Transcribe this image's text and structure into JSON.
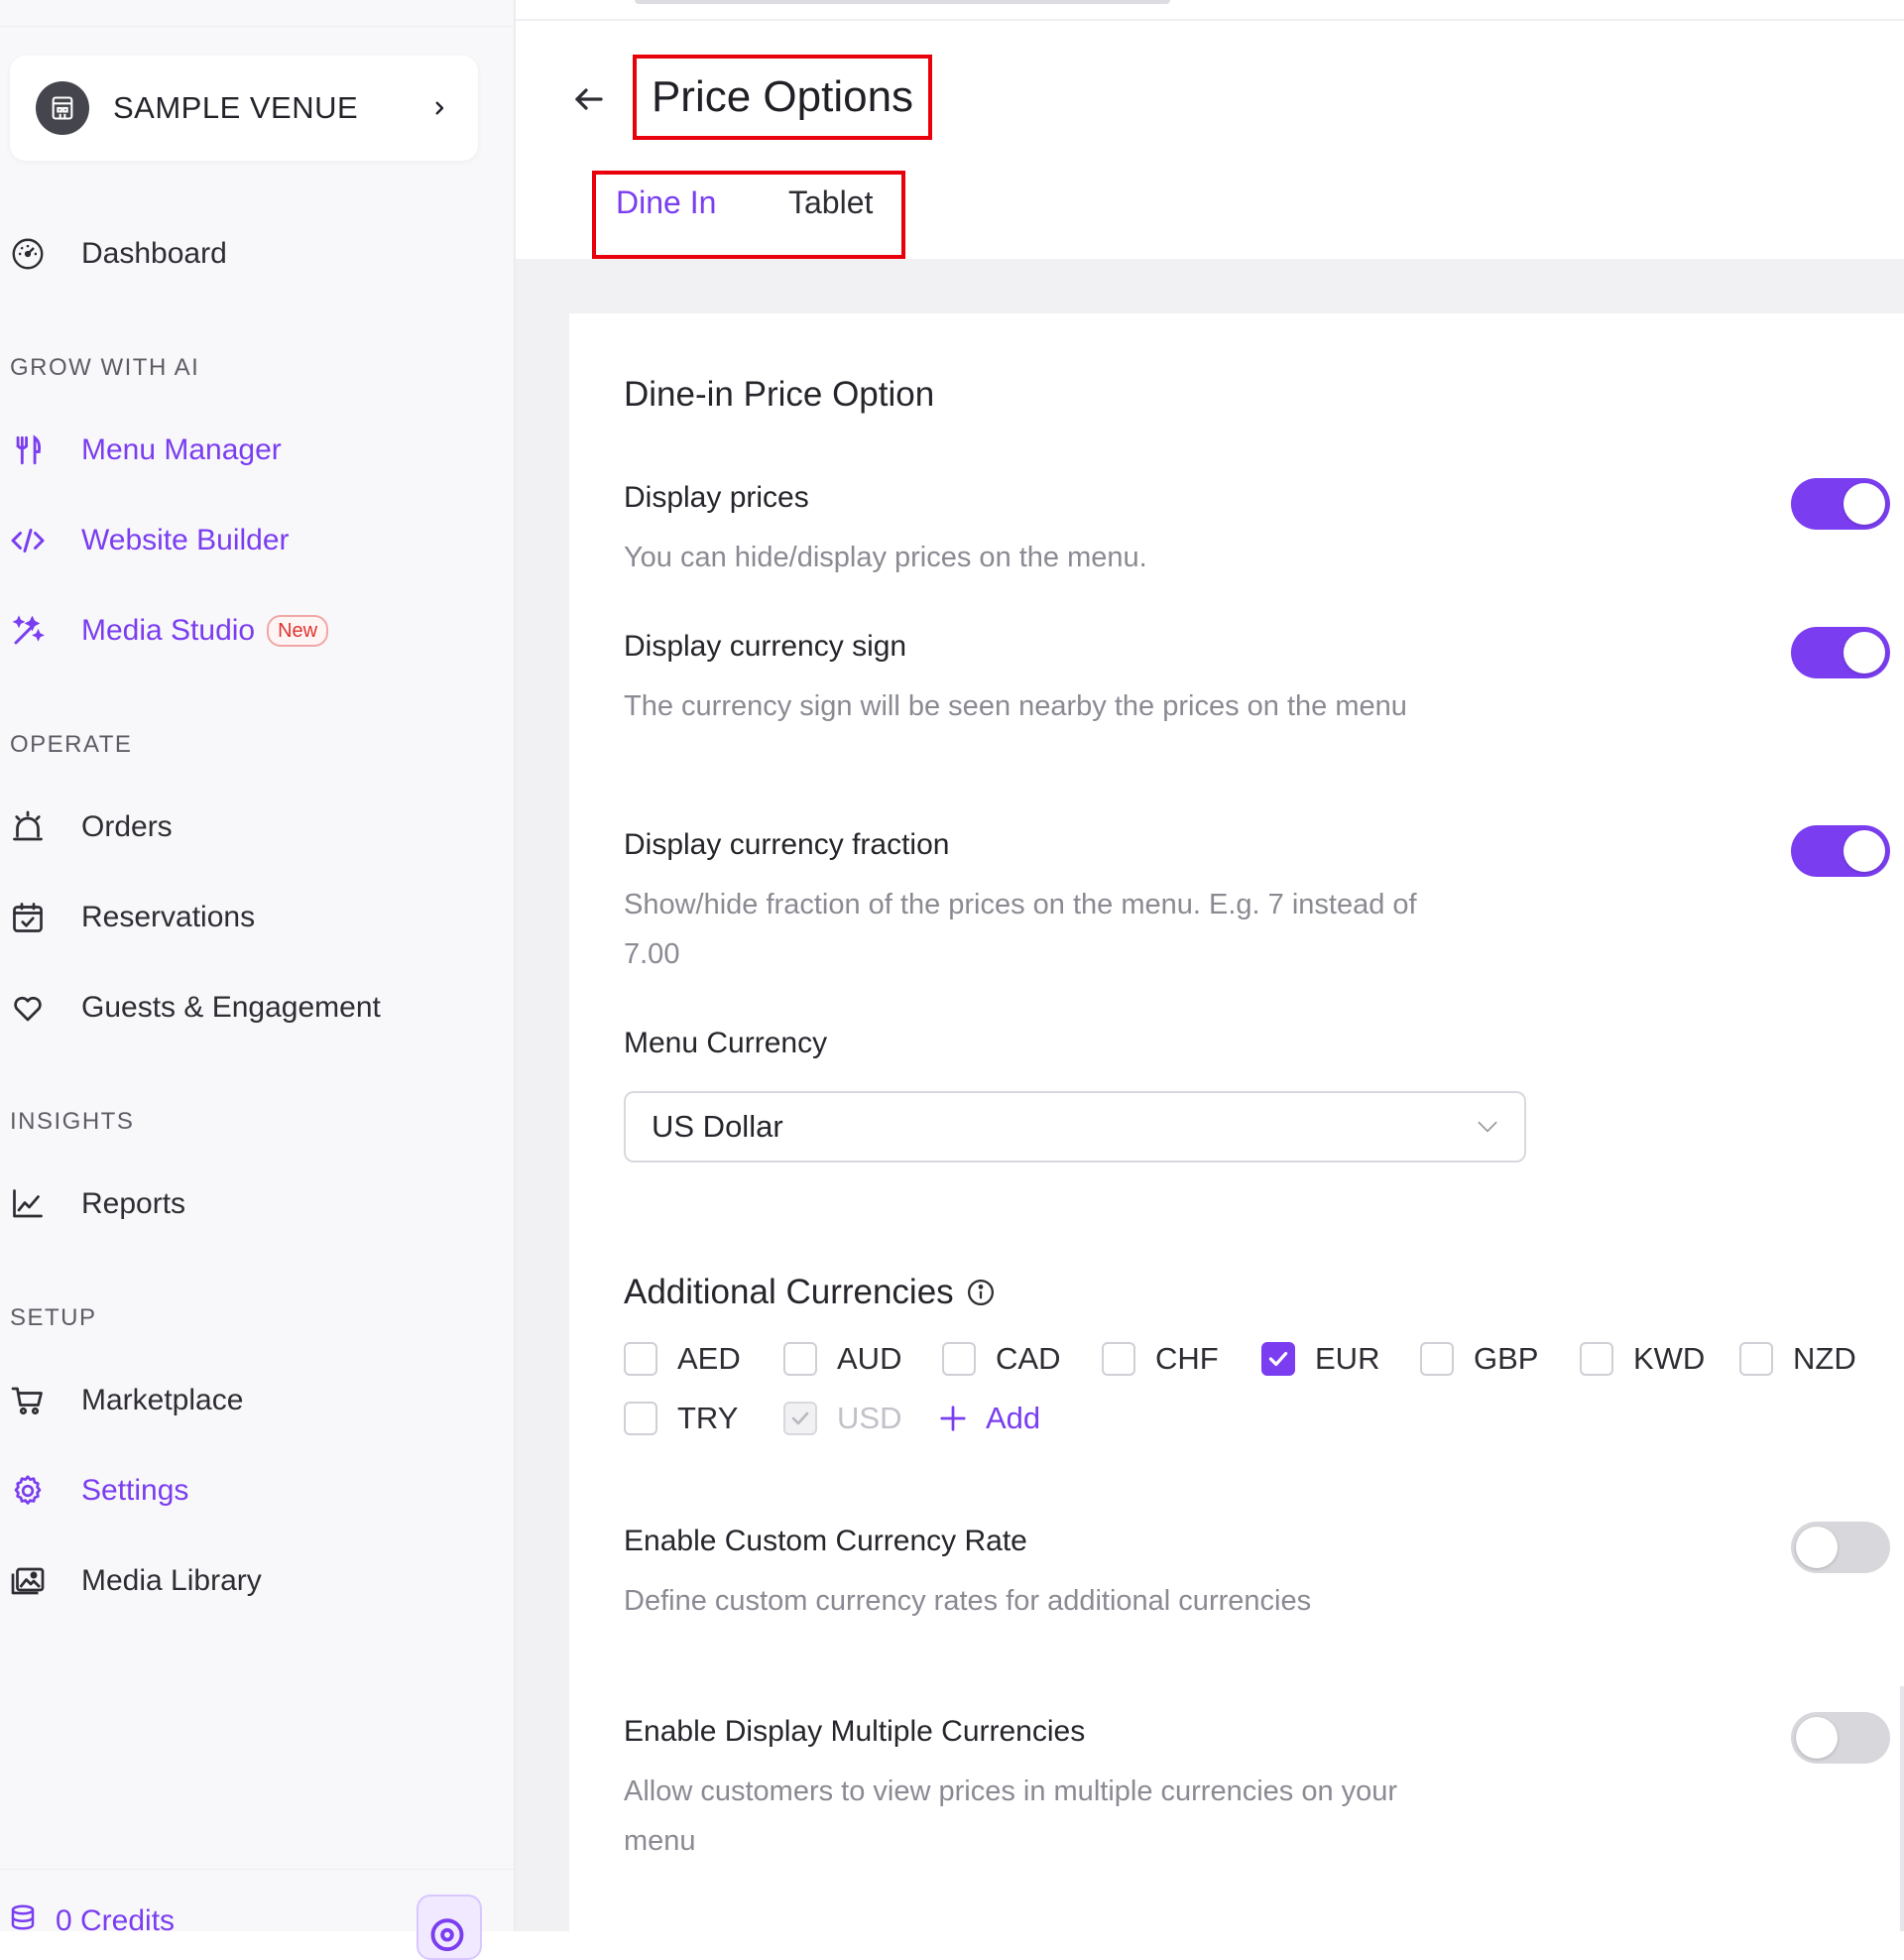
{
  "sidebar": {
    "venue_name": "SAMPLE VENUE",
    "dashboard": "Dashboard",
    "sections": {
      "grow": "GROW WITH AI",
      "operate": "OPERATE",
      "insights": "INSIGHTS",
      "setup": "SETUP"
    },
    "items": {
      "menu_manager": "Menu Manager",
      "website_builder": "Website Builder",
      "media_studio": "Media Studio",
      "media_studio_badge": "New",
      "orders": "Orders",
      "reservations": "Reservations",
      "guests": "Guests & Engagement",
      "reports": "Reports",
      "marketplace": "Marketplace",
      "settings": "Settings",
      "media_library": "Media Library"
    },
    "credits": "0 Credits"
  },
  "header": {
    "title": "Price Options",
    "tabs": [
      "Dine In",
      "Tablet"
    ],
    "active_tab": "Dine In"
  },
  "card": {
    "heading": "Dine-in Price Option",
    "display_prices": {
      "title": "Display prices",
      "desc": "You can hide/display prices on the menu.",
      "enabled": true
    },
    "currency_sign": {
      "title": "Display currency sign",
      "desc": "The currency sign will be seen nearby the prices on the menu",
      "enabled": true
    },
    "currency_fraction": {
      "title": "Display currency fraction",
      "desc": "Show/hide fraction of the prices on the menu. E.g. 7 instead of 7.00",
      "enabled": true
    },
    "menu_currency": {
      "label": "Menu Currency",
      "value": "US Dollar"
    },
    "additional": {
      "heading": "Additional Currencies",
      "currencies": [
        {
          "code": "AED",
          "checked": false,
          "disabled": false
        },
        {
          "code": "AUD",
          "checked": false,
          "disabled": false
        },
        {
          "code": "CAD",
          "checked": false,
          "disabled": false
        },
        {
          "code": "CHF",
          "checked": false,
          "disabled": false
        },
        {
          "code": "EUR",
          "checked": true,
          "disabled": false
        },
        {
          "code": "GBP",
          "checked": false,
          "disabled": false
        },
        {
          "code": "KWD",
          "checked": false,
          "disabled": false
        },
        {
          "code": "NZD",
          "checked": false,
          "disabled": false
        },
        {
          "code": "TRY",
          "checked": false,
          "disabled": false
        },
        {
          "code": "USD",
          "checked": true,
          "disabled": true
        }
      ],
      "add_label": "Add"
    },
    "custom_rate": {
      "title": "Enable Custom Currency Rate",
      "desc": "Define custom currency rates for additional currencies",
      "enabled": false
    },
    "multiple_currencies": {
      "title": "Enable Display Multiple Currencies",
      "desc": "Allow customers to view prices in multiple currencies on your menu",
      "enabled": false
    }
  },
  "colors": {
    "accent": "#7a3df0",
    "highlight_box": "#e8000b",
    "badge_red": "#e0342f"
  }
}
